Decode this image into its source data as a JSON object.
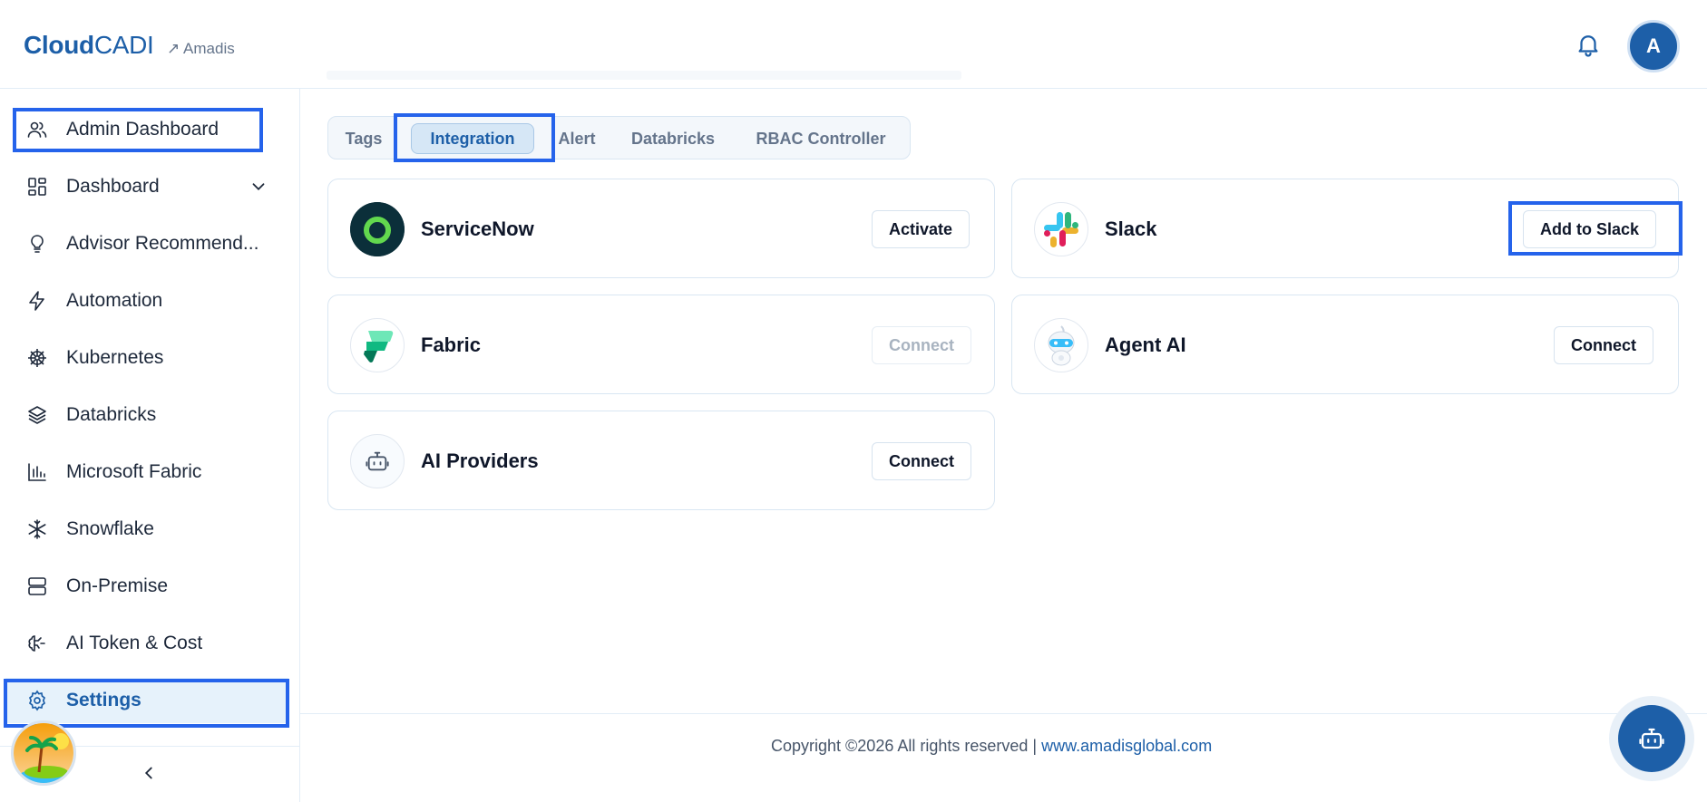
{
  "header": {
    "logo_bold": "Cloud",
    "logo_light": "CADI",
    "logo_sub": "↗ Amadis",
    "avatar_initial": "A"
  },
  "sidebar": {
    "items": [
      {
        "label": "Admin Dashboard",
        "icon": "users-icon"
      },
      {
        "label": "Dashboard",
        "icon": "dashboard-grid-icon"
      },
      {
        "label": "Advisor Recommend...",
        "icon": "lightbulb-icon"
      },
      {
        "label": "Automation",
        "icon": "lightning-icon"
      },
      {
        "label": "Kubernetes",
        "icon": "helm-icon"
      },
      {
        "label": "Databricks",
        "icon": "layers-icon"
      },
      {
        "label": "Microsoft Fabric",
        "icon": "bar-chart-icon"
      },
      {
        "label": "Snowflake",
        "icon": "snowflake-icon"
      },
      {
        "label": "On-Premise",
        "icon": "server-icon"
      },
      {
        "label": "AI Token & Cost",
        "icon": "brain-icon"
      },
      {
        "label": "Settings",
        "icon": "gear-icon"
      }
    ],
    "active": "Settings"
  },
  "tabs": [
    {
      "label": "Tags"
    },
    {
      "label": "Integration"
    },
    {
      "label": "Alert"
    },
    {
      "label": "Databricks"
    },
    {
      "label": "RBAC Controller"
    }
  ],
  "active_tab": "Integration",
  "integrations": [
    {
      "name": "ServiceNow",
      "button": "Activate",
      "enabled": true
    },
    {
      "name": "Slack",
      "button": "Add to Slack",
      "enabled": true
    },
    {
      "name": "Fabric",
      "button": "Connect",
      "enabled": false
    },
    {
      "name": "Agent AI",
      "button": "Connect",
      "enabled": true
    },
    {
      "name": "AI Providers",
      "button": "Connect",
      "enabled": true
    }
  ],
  "footer": {
    "copyright": "Copyright ©2026 All rights reserved |",
    "link": "www.amadisglobal.com"
  },
  "colors": {
    "brand": "#1d5fa8",
    "highlight": "#2563eb",
    "active_bg": "#e6f2fb"
  }
}
